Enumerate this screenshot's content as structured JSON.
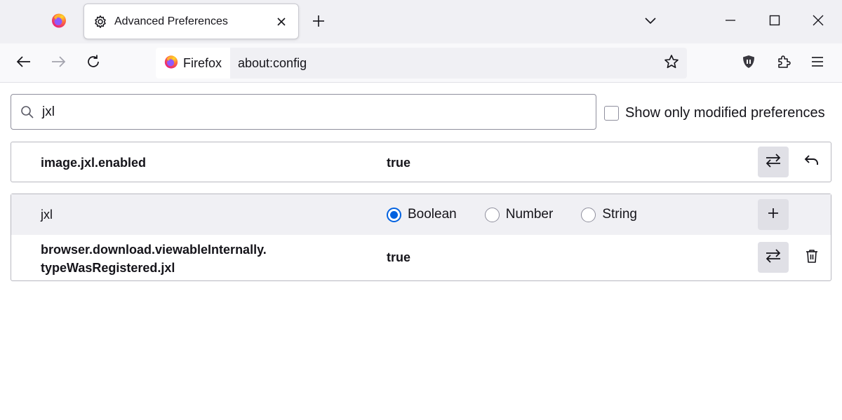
{
  "tabs": {
    "active_title": "Advanced Preferences"
  },
  "urlbar": {
    "identity_label": "Firefox",
    "url": "about:config"
  },
  "search": {
    "value": "jxl"
  },
  "options": {
    "show_modified_label": "Show only modified preferences"
  },
  "prefs": [
    {
      "name": "image.jxl.enabled",
      "value": "true"
    }
  ],
  "new_pref": {
    "name": "jxl",
    "types": [
      "Boolean",
      "Number",
      "String"
    ],
    "selected_type": "Boolean"
  },
  "results": [
    {
      "name_line1": "browser.download.viewableInternally.",
      "name_line2": "typeWasRegistered.jxl",
      "value": "true"
    }
  ],
  "icons": {
    "firefox_tab": "firefox-logo-icon",
    "tab_icon": "gear-icon",
    "close": "close-icon",
    "new_tab": "plus-icon",
    "tab_list": "chevron-down-icon",
    "minimize": "minimize-icon",
    "maximize": "maximize-icon",
    "window_close": "close-icon",
    "back": "arrow-left-icon",
    "forward": "arrow-right-icon",
    "reload": "reload-icon",
    "bookmark": "star-icon",
    "ublock": "shield-icon",
    "extensions": "puzzle-icon",
    "menu": "hamburger-icon",
    "toggle": "toggle-arrows-icon",
    "reset": "undo-icon",
    "add": "plus-icon",
    "delete": "trash-icon"
  },
  "colors": {
    "accent": "#0061e0",
    "firefox_orange": "#ff7139",
    "firefox_purple": "#9059ff"
  }
}
